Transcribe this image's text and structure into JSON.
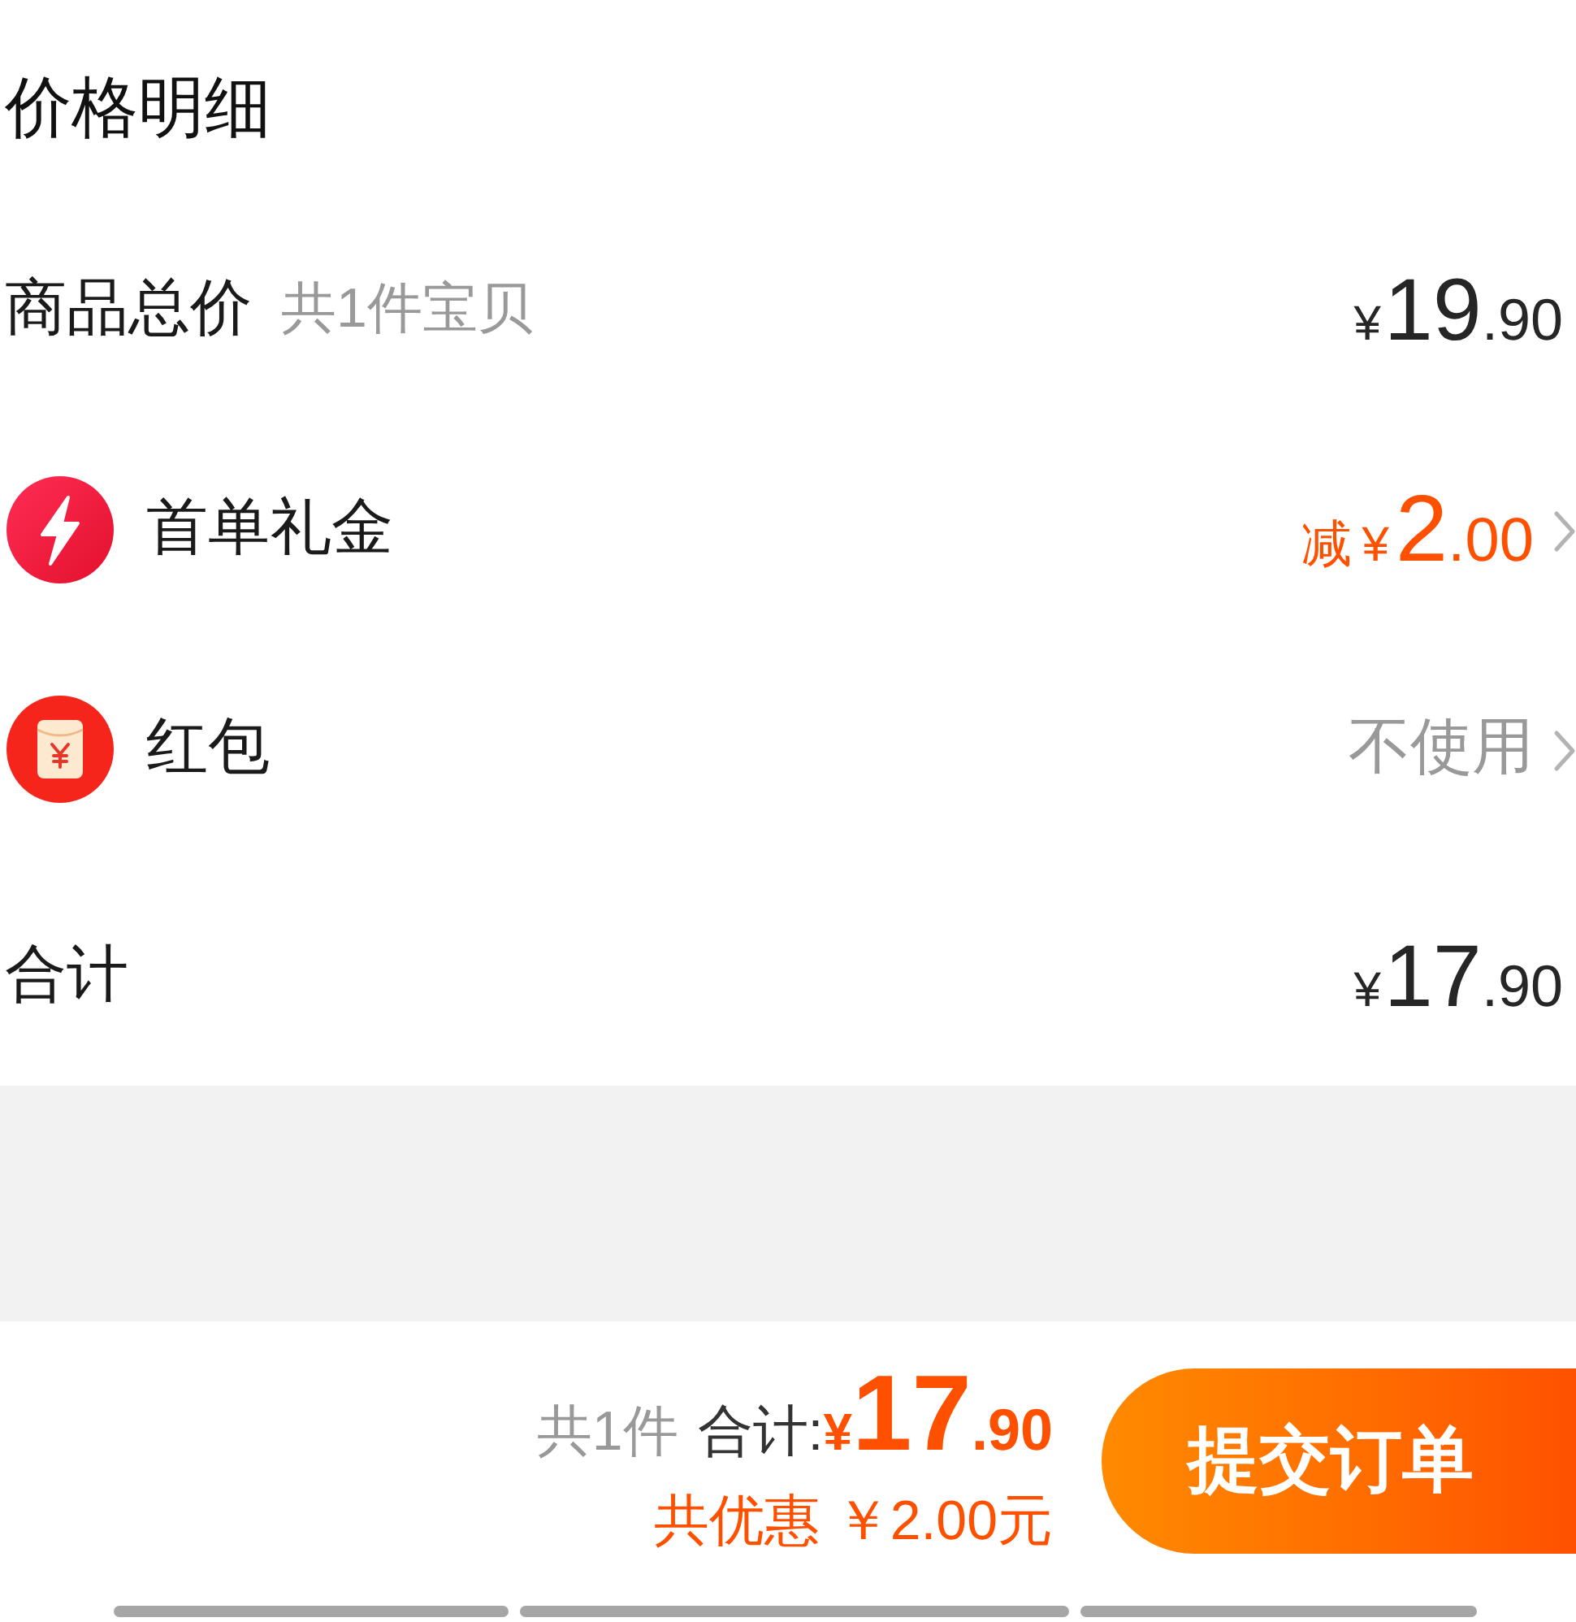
{
  "header": {
    "title": "价格明细"
  },
  "rows": [
    {
      "kind": "price",
      "label": "商品总价",
      "note": "共1件宝贝",
      "amount": {
        "currency": "¥",
        "integer": "19",
        "decimal": ".90"
      }
    },
    {
      "kind": "gift",
      "label": "首单礼金",
      "prefix": "减",
      "amount": {
        "currency": "¥",
        "integer": "2",
        "decimal": ".00"
      }
    },
    {
      "kind": "packet",
      "label": "红包",
      "value": "不使用"
    },
    {
      "kind": "price",
      "label": "合计",
      "amount": {
        "currency": "¥",
        "integer": "17",
        "decimal": ".90"
      }
    }
  ],
  "footer": {
    "count": "共1件",
    "total_label": "合计:",
    "total": {
      "currency": "¥",
      "integer": "17",
      "decimal": ".90"
    },
    "savings": "共优惠 ￥2.00元",
    "submit_button": "提交订单"
  }
}
